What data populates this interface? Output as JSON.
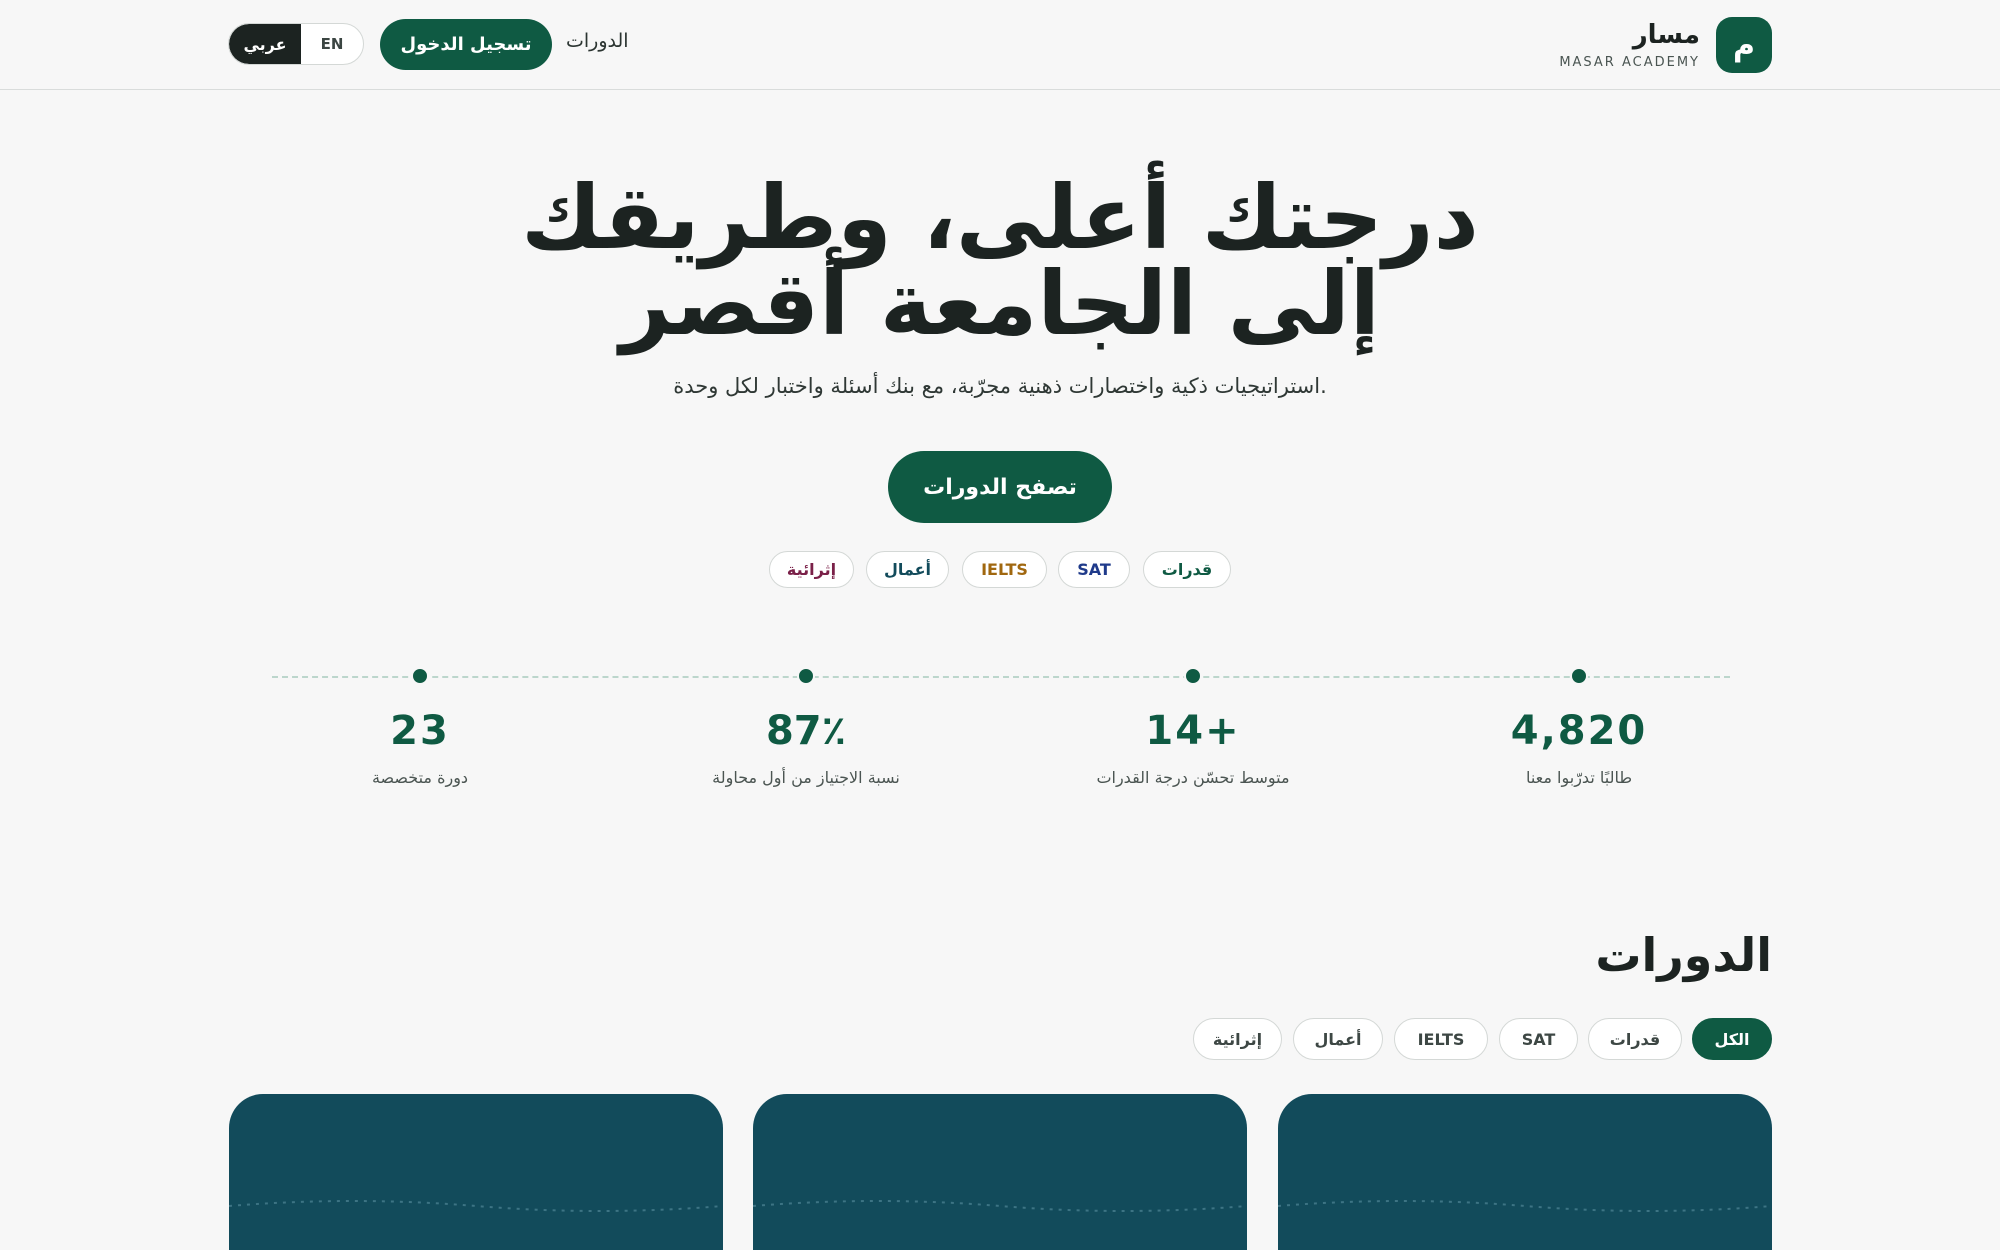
{
  "header": {
    "brand_logo": "م",
    "brand_name": "مسار",
    "brand_sub": "MASAR ACADEMY",
    "nav_courses": "الدورات",
    "login": "تسجيل الدخول",
    "lang_ar": "عربي",
    "lang_en": "EN"
  },
  "hero": {
    "title_line1": "درجتك أعلى، وطريقك",
    "title_line2": "إلى الجامعة أقصر",
    "subtitle": "استراتيجيات ذكية واختصارات ذهنية مجرّبة، مع بنك أسئلة واختبار لكل وحدة.",
    "cta": "تصفح الدورات",
    "chips": [
      {
        "label": "قدرات",
        "color": "#0f5a43"
      },
      {
        "label": "SAT",
        "color": "#1f3a8a"
      },
      {
        "label": "IELTS",
        "color": "#a0670f"
      },
      {
        "label": "أعمال",
        "color": "#124b5b"
      },
      {
        "label": "إثرائية",
        "color": "#7a2048"
      }
    ]
  },
  "stats": [
    {
      "value": "4,820",
      "label": "طالبًا تدرّبوا معنا"
    },
    {
      "value": "14+",
      "label": "متوسط تحسّن درجة القدرات"
    },
    {
      "value": "87٪",
      "label": "نسبة الاجتياز من أول محاولة"
    },
    {
      "value": "23",
      "label": "دورة متخصصة"
    }
  ],
  "courses": {
    "title": "الدورات",
    "filters": [
      "الكل",
      "قدرات",
      "SAT",
      "IELTS",
      "أعمال",
      "إثرائية"
    ],
    "active_filter": "الكل"
  },
  "colors": {
    "primary": "#0f5a43",
    "card": "#124b5b",
    "background": "#f7f7f7"
  }
}
